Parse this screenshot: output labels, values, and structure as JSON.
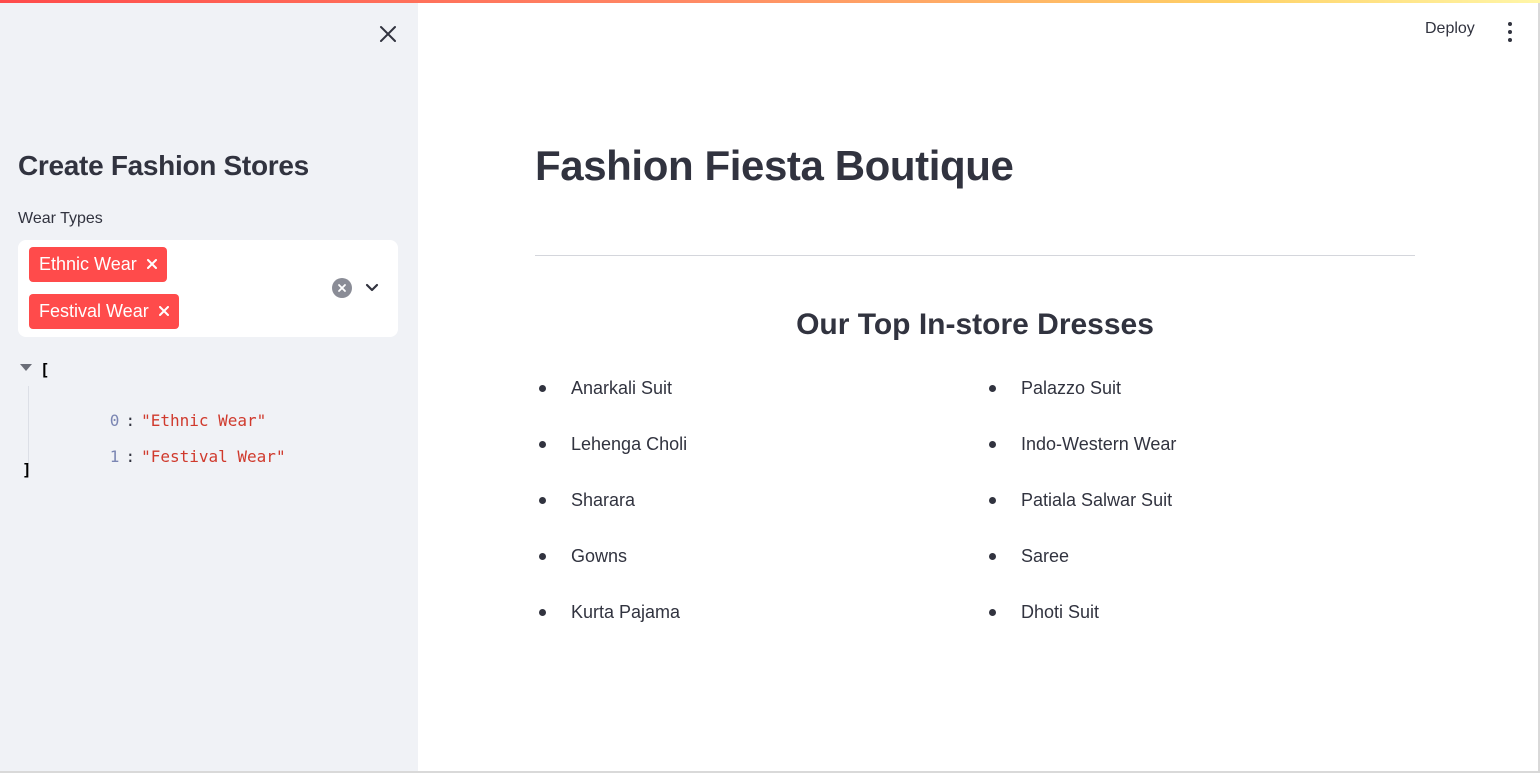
{
  "sidebar": {
    "title": "Create Fashion Stores",
    "field_label": "Wear Types",
    "selected": [
      "Ethnic Wear",
      "Festival Wear"
    ],
    "json_output": {
      "open": "[",
      "close": "]",
      "items": [
        {
          "index": "0",
          "value": "\"Ethnic Wear\""
        },
        {
          "index": "1",
          "value": "\"Festival Wear\""
        }
      ]
    }
  },
  "header": {
    "deploy_label": "Deploy"
  },
  "main": {
    "title": "Fashion Fiesta Boutique",
    "section_title": "Our Top In-store Dresses",
    "dresses_left": [
      "Anarkali Suit",
      "Lehenga Choli",
      "Sharara",
      "Gowns",
      "Kurta Pajama"
    ],
    "dresses_right": [
      "Palazzo Suit",
      "Indo-Western Wear",
      "Patiala Salwar Suit",
      "Saree",
      "Dhoti Suit"
    ]
  },
  "colors": {
    "accent": "#ff4b4b",
    "sidebar_bg": "#f0f2f6",
    "text": "#31333f"
  },
  "icons": {
    "close": "close-icon",
    "chip_remove": "x-icon",
    "clear_all": "clear-circle-icon",
    "dropdown": "chevron-down-icon",
    "menu": "vertical-dots-icon",
    "json_toggle": "caret-down-icon"
  }
}
